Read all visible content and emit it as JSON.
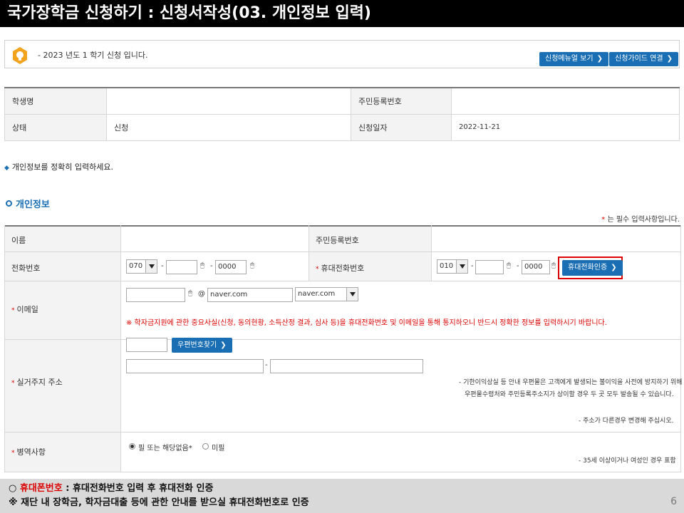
{
  "header": {
    "title": "국가장학금 신청하기 : 신청서작성(03. 개인정보 입력)"
  },
  "notice": {
    "text": "- 2023 년도 1 학기 신청 입니다.",
    "manual_button": "신청메뉴얼 보기",
    "guide_button": "신청가이드 연결"
  },
  "applicant_info": {
    "name_label": "학생명",
    "name_value": "",
    "rrn_label": "주민등록번호",
    "rrn_value": "",
    "status_label": "상태",
    "status_value": "신청",
    "date_label": "신청일자",
    "date_value": "2022-11-21"
  },
  "guide_text": "개인정보를 정확히 입력하세요.",
  "section_title": "개인정보",
  "required_note": "는 필수 입력사항입니다.",
  "form": {
    "name_label": "이름",
    "rrn_label": "주민등록번호",
    "phone_label": "전화번호",
    "phone_area": "070",
    "phone_middle": "",
    "phone_last": "0000",
    "mobile_label": "휴대전화번호",
    "mobile_prefix": "010",
    "mobile_middle": "",
    "mobile_last": "0000",
    "mobile_verify_button": "휴대전화인증",
    "email_label": "이메일",
    "email_id": "",
    "email_domain": "naver.com",
    "email_domain_select": "naver.com",
    "email_warning": "※ 학자금지원에 관한 중요사실(신청, 동의현황, 소득산정 결과, 심사 등)을 휴대전화번호 및 이메일을 통해 통지하오니 반드시 정확한 정보를 입력하시기 바랍니다.",
    "address_label": "실거주지 주소",
    "zip_value": "",
    "zip_button": "우편번호찾기",
    "address1": "",
    "address2": "",
    "address_note1": "- 기한이익상실 등 안내 우편물은 고객에게 발생되는 불이익을 사전에 방지하기 위해",
    "address_note2": "우편물수령처와 주민등록주소지가 상이할 경우 두 곳 모두 발송될 수 있습니다.",
    "address_note3": "- 주소가 다른경우 변경해 주십시오.",
    "military_label": "병역사항",
    "military_option1": "필 또는 해당없음*",
    "military_option2": "미필",
    "military_note": "- 35세 이상이거나 여성인 경우 표함"
  },
  "footer": {
    "line1_prefix": "○ ",
    "line1_red": "휴대폰번호",
    "line1_rest": " : 휴대전화번호 입력 후 휴대전화 인증",
    "line2": "※ 재단 내 장학금, 학자금대출 등에 관한 안내를 받으실 휴대전화번호로 인증",
    "page_number": "6"
  },
  "colors": {
    "accent_blue": "#1a6fb4",
    "highlight_red": "#dd0000",
    "title_bg": "#000000",
    "footer_bg": "#d9d9d9"
  },
  "icons": {
    "notice": "bulb-icon",
    "input_hint": "mouse-icon",
    "button_arrow": "chevron-right-icon"
  }
}
